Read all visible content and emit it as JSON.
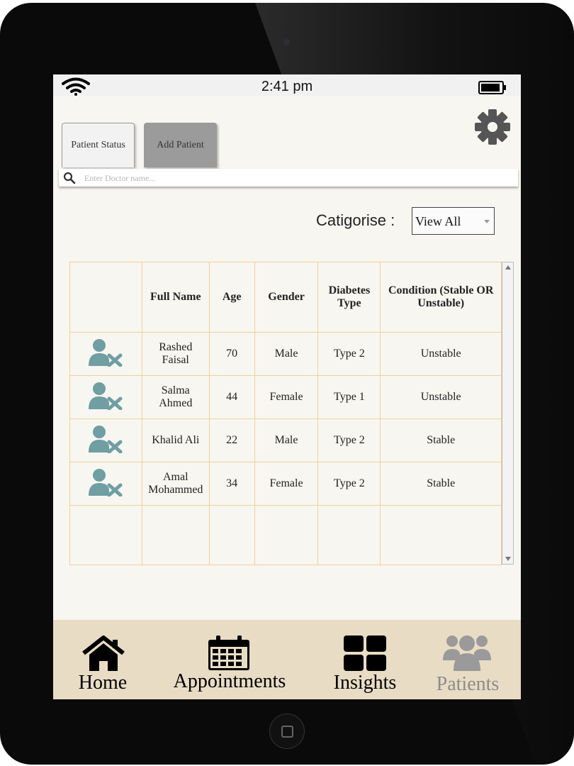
{
  "status_bar": {
    "time": "2:41 pm"
  },
  "tabs": [
    {
      "label": "Patient Status",
      "active": true
    },
    {
      "label": "Add Patient",
      "active": false
    }
  ],
  "search": {
    "placeholder": "Enter Doctor name...",
    "value": ""
  },
  "filter": {
    "label": "Catigorise :",
    "selected": "View All"
  },
  "table": {
    "headers": [
      "",
      "Full Name",
      "Age",
      "Gender",
      "Diabetes Type",
      "Condition (Stable OR Unstable)"
    ],
    "rows": [
      {
        "name": "Rashed Faisal",
        "age": "70",
        "gender": "Male",
        "type": "Type 2",
        "condition": "Unstable"
      },
      {
        "name": "Salma Ahmed",
        "age": "44",
        "gender": "Female",
        "type": "Type 1",
        "condition": "Unstable"
      },
      {
        "name": "Khalid Ali",
        "age": "22",
        "gender": "Male",
        "type": "Type 2",
        "condition": "Stable"
      },
      {
        "name": "Amal Mohammed",
        "age": "34",
        "gender": "Female",
        "type": "Type 2",
        "condition": "Stable"
      }
    ]
  },
  "nav": {
    "home": "Home",
    "appointments": "Appointments",
    "insights": "Insights",
    "patients": "Patients",
    "active": "patients"
  },
  "colors": {
    "screen_bg": "#f8f6f0",
    "table_border": "#f2cf9c",
    "remove_icon": "#6f9ea3",
    "nav_bg": "#e9dcc4",
    "inactive_tab": "#9b9b9b",
    "active_nav": "#8c8c8c"
  },
  "icons": [
    "wifi-icon",
    "battery-icon",
    "gear-icon",
    "search-icon",
    "remove-user-icon",
    "home-icon",
    "calendar-icon",
    "grid-icon",
    "users-icon"
  ]
}
